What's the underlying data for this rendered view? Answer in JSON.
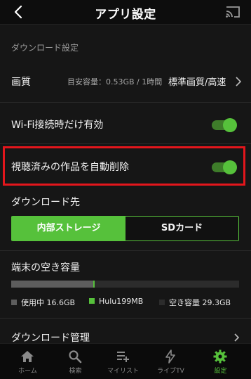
{
  "header": {
    "title": "アプリ設定",
    "back_icon": "chevron-left-icon",
    "cast_icon": "cast-icon"
  },
  "download_settings": {
    "section_title": "ダウンロード設定",
    "quality": {
      "label": "画質",
      "estimate": "目安容量：0.53GB / 1時間",
      "value": "標準画質/高速"
    },
    "wifi_only": {
      "label": "Wi-Fi接続時だけ有効",
      "enabled": true
    },
    "auto_delete": {
      "label": "視聴済みの作品を自動削除",
      "enabled": true
    },
    "destination": {
      "label": "ダウンロード先",
      "options": [
        "内部ストレージ",
        "SDカード"
      ],
      "selected": "内部ストレージ"
    },
    "storage": {
      "label": "端末の空き容量",
      "used_fraction": 0.36,
      "hulu_fraction": 0.005,
      "legend": {
        "used": "使用中 16.6GB",
        "hulu": "Hulu199MB",
        "free": "空き容量 29.3GB"
      }
    },
    "manage": {
      "label": "ダウンロード管理"
    }
  },
  "bottom_nav": {
    "items": [
      {
        "label": "ホーム",
        "icon": "home-icon",
        "active": false
      },
      {
        "label": "検索",
        "icon": "search-icon",
        "active": false
      },
      {
        "label": "マイリスト",
        "icon": "playlist-add-icon",
        "active": false
      },
      {
        "label": "ライブTV",
        "icon": "live-tv-icon",
        "active": false
      },
      {
        "label": "設定",
        "icon": "gear-icon",
        "active": true
      }
    ]
  },
  "colors": {
    "accent": "#56c13b",
    "background": "#161616",
    "highlight": "#e3161c",
    "used_storage": "#5d5d5d",
    "free_storage": "#2c2c2c"
  }
}
